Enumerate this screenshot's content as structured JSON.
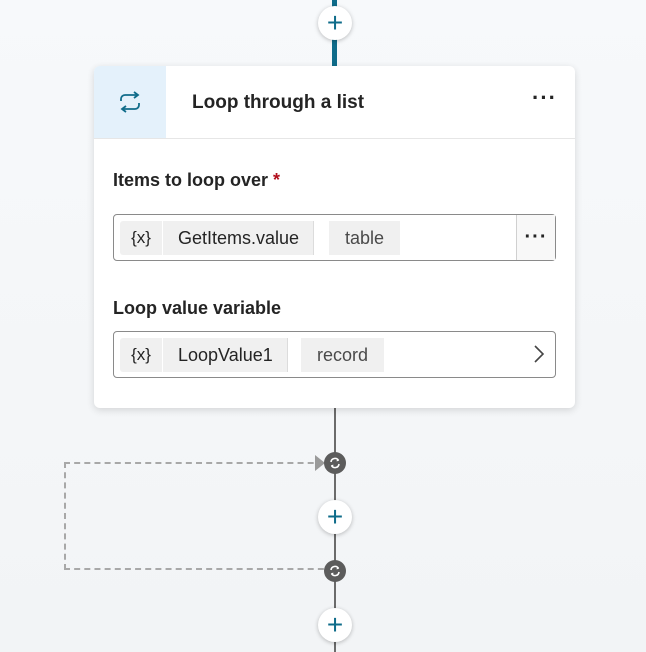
{
  "card": {
    "title": "Loop through a list",
    "more_label": "···",
    "icon": "loop-icon",
    "accent_color": "#0f6c8a"
  },
  "items_field": {
    "label": "Items to loop over",
    "required_mark": "*",
    "var_badge": "{x}",
    "value": "GetItems.value",
    "type": "table",
    "more_label": "···"
  },
  "loop_value_field": {
    "label": "Loop value variable",
    "var_badge": "{x}",
    "value": "LoopValue1",
    "type": "record",
    "chevron_icon": "chevron-right-icon"
  },
  "canvas": {
    "add_button_symbol": "+"
  }
}
